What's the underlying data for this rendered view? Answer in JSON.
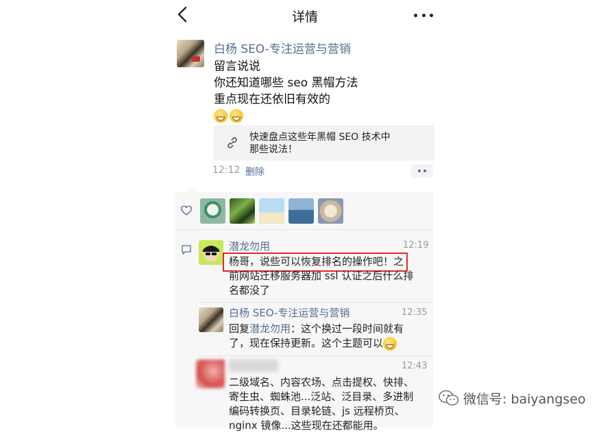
{
  "nav": {
    "title": "详情",
    "back_icon": "chevron-left-icon",
    "more_icon": "more-dots-icon"
  },
  "post": {
    "author": "白杨 SEO-专注运营与营销",
    "lines": [
      "留言说说",
      "你还知道哪些 seo 黑帽方法",
      "重点现在还依旧有效的"
    ],
    "emojis": [
      "grin-emoji",
      "smile-emoji"
    ],
    "link_card": {
      "line1": "快速盘点这些年黑帽 SEO 技术中",
      "line2": "那些说法！"
    },
    "time": "12:12",
    "delete_label": "删除"
  },
  "comments": [
    {
      "name": "潜龙勿用",
      "time": "12:19",
      "text_line1_highlight": "杨哥，说些可以恢复排名的操作吧！",
      "text_line1_rest": "之",
      "text_line2": "前网站迁移服务器加 ssl 认证之后什么排",
      "text_line3": "名都没了"
    },
    {
      "name": "白杨 SEO-专注运营与营销",
      "time": "12:35",
      "reply_prefix": "回复",
      "reply_to": "潜龙勿用",
      "text_line1_rest": "：这个换过一段时间就有",
      "text_line2": "了，现在保持更新。这个主题可以"
    },
    {
      "name": "",
      "time": "12:43",
      "lines": [
        "二级域名、内容农场、点击提权、快排、",
        "寄生虫、蜘蛛池...泛站、泛目录、多进制",
        "编码转换页、目录轮链、js 远程桥页、",
        "nginx 镜像...这些现在还都能用。"
      ]
    }
  ],
  "watermark": {
    "text": "微信号: baiyangseo"
  },
  "colors": {
    "link": "#576b95",
    "highlight": "#e0282b",
    "panel": "#f7f7f7"
  }
}
